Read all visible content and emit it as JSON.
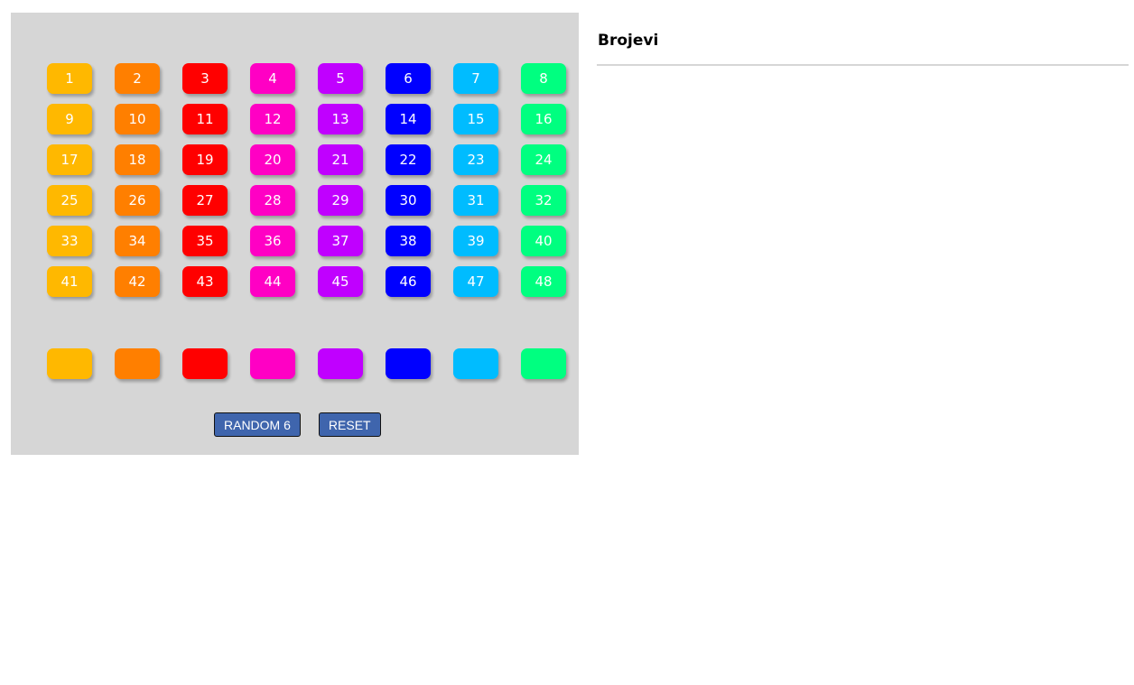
{
  "numbers": [
    "1",
    "2",
    "3",
    "4",
    "5",
    "6",
    "7",
    "8",
    "9",
    "10",
    "11",
    "12",
    "13",
    "14",
    "15",
    "16",
    "17",
    "18",
    "19",
    "20",
    "21",
    "22",
    "23",
    "24",
    "25",
    "26",
    "27",
    "28",
    "29",
    "30",
    "31",
    "32",
    "33",
    "34",
    "35",
    "36",
    "37",
    "38",
    "39",
    "40",
    "41",
    "42",
    "43",
    "44",
    "45",
    "46",
    "47",
    "48"
  ],
  "column_colors": [
    "#ffb800",
    "#ff7f00",
    "#ff0000",
    "#ff00c4",
    "#c000ff",
    "#0000ff",
    "#00bcff",
    "#00ff80"
  ],
  "controls": {
    "random_label": "RANDOM 6",
    "reset_label": "RESET"
  },
  "sidebar": {
    "title": "Brojevi"
  }
}
